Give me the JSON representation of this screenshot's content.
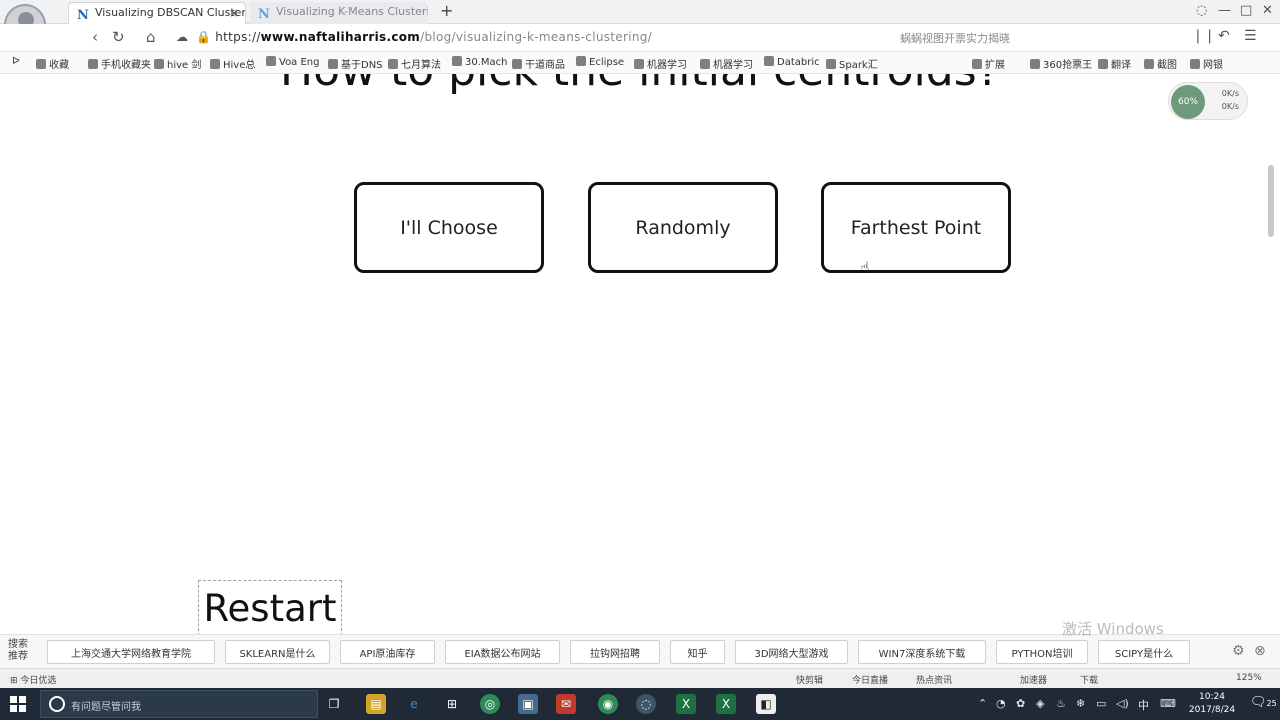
{
  "browser": {
    "tabs": [
      {
        "label": "Visualizing DBSCAN Clusterin",
        "favicon": "N"
      },
      {
        "label": "Visualizing K-Means Clusterin",
        "favicon": "N"
      }
    ],
    "new_tab": "+",
    "url": {
      "scheme": "https://",
      "host": "www.naftaliharris.com",
      "path": "/blog/visualizing-k-means-clustering/"
    },
    "news_line": "蜗蜗视图开票实力揭晓",
    "bookmarks": [
      "收藏",
      "手机收藏夹",
      "hive 剑",
      "Hive总",
      "Voa Eng",
      "基于DNS",
      "七月算法",
      "30.Mach",
      "干道商品",
      "Eclipse",
      "机器学习",
      "机器学习",
      "Databric",
      "Spark汇"
    ],
    "ext_labels": [
      "扩展",
      "360抢票王",
      "翻译",
      "截图",
      "网银"
    ],
    "net_widget": {
      "percent": "60%",
      "up": "0K/s",
      "down": "0K/s"
    }
  },
  "page": {
    "heading": "How to pick the initial centroids?",
    "choices": [
      "I'll Choose",
      "Randomly",
      "Farthest Point"
    ],
    "restart_label": "Restart"
  },
  "suggest_bar": {
    "label_line1": "搜索",
    "label_line2": "推荐",
    "chips": [
      "上海交通大学网络教育学院",
      "SKLEARN是什么",
      "API原油库存",
      "EIA数据公布网站",
      "拉钩网招聘",
      "知乎",
      "3D网络大型游戏",
      "WIN7深度系统下载",
      "PYTHON培训",
      "SCIPY是什么"
    ],
    "watermark": "激活 Windows"
  },
  "status_strip": {
    "left": "今日优选",
    "items": [
      "快剪辑",
      "今日直播",
      "热点资讯",
      "加速器",
      "下载",
      "125%"
    ]
  },
  "taskbar": {
    "search_placeholder": "有问题尽管问我",
    "tray_lang": "中",
    "time": "10:24",
    "date": "2017/8/24",
    "notifications": "25"
  }
}
